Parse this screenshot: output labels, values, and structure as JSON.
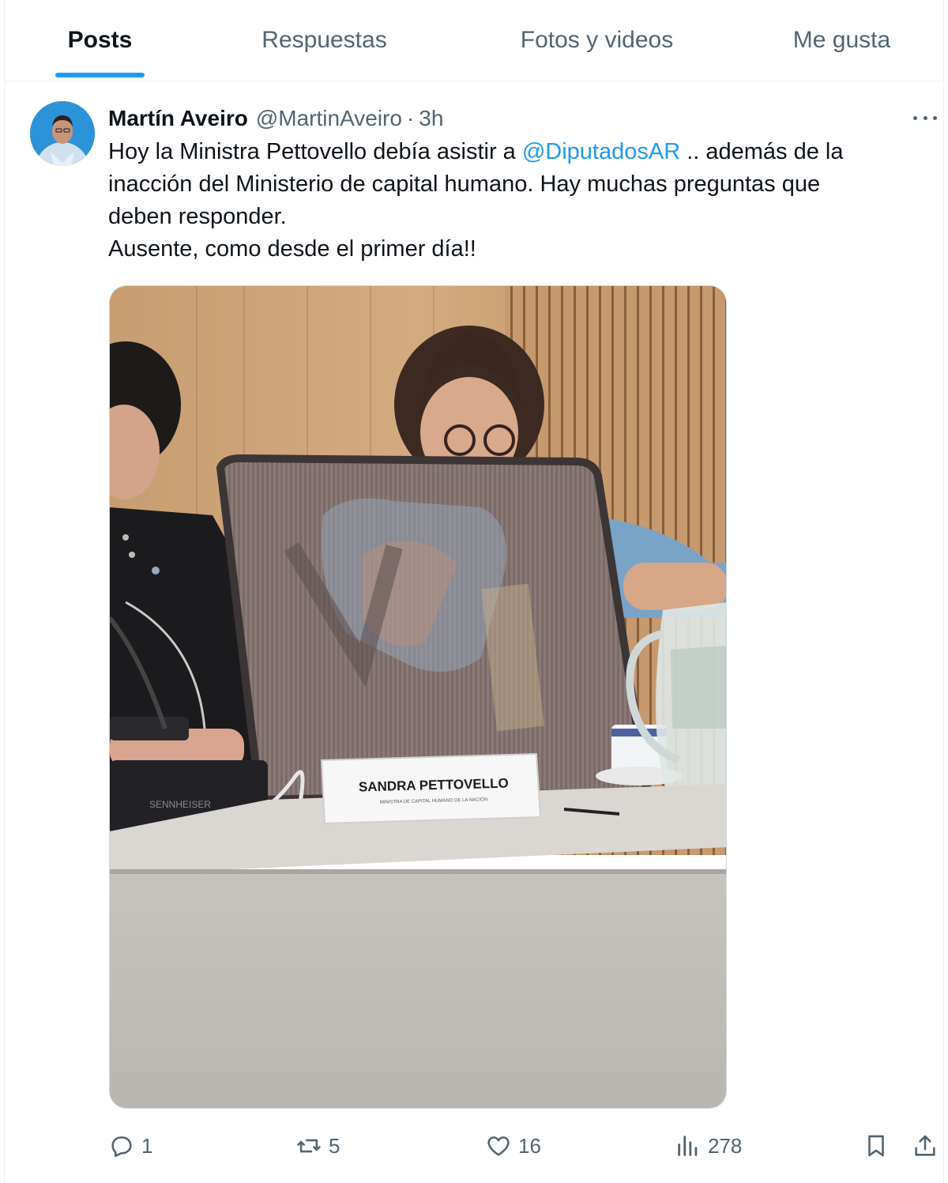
{
  "tabs": [
    {
      "label": "Posts",
      "active": true
    },
    {
      "label": "Respuestas",
      "active": false
    },
    {
      "label": "Fotos y videos",
      "active": false
    },
    {
      "label": "Me gusta",
      "active": false
    }
  ],
  "post": {
    "author_name": "Martín Aveiro",
    "author_handle": "@MartinAveiro",
    "separator": "·",
    "time": "3h",
    "text_line1_pre": "Hoy la Ministra Pettovello debía asistir a ",
    "mention": "@DiputadosAR",
    "text_line1_post": " .. además de la",
    "text_line2": "inacción del Ministerio de capital humano. Hay muchas preguntas que",
    "text_line3": "deben responder.",
    "text_line4": "Ausente, como desde el primer día!!",
    "image": {
      "nameplate_name": "SANDRA PETTOVELLO",
      "nameplate_title": "MINISTRA DE CAPITAL HUMANO DE LA NACIÓN",
      "microphone_brand": "SENNHEISER"
    }
  },
  "actions": {
    "replies": "1",
    "reposts": "5",
    "likes": "16",
    "views": "278"
  },
  "icons": {
    "more": "more-dots-icon",
    "reply": "reply-icon",
    "repost": "repost-icon",
    "like": "heart-icon",
    "views": "views-icon",
    "bookmark": "bookmark-icon",
    "share": "share-icon"
  },
  "colors": {
    "accent": "#1d9bf0",
    "text_primary": "#0f1419",
    "text_secondary": "#536471",
    "border": "#eff3f4"
  }
}
